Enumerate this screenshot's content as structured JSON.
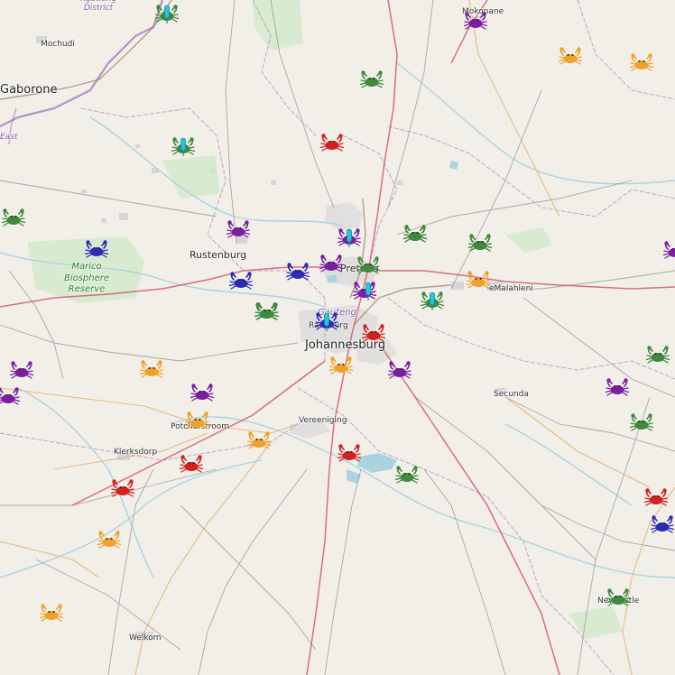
{
  "map": {
    "places": {
      "gaborone": "Gaborone",
      "mochudi": "Mochudi",
      "mokopane": "Mokopane",
      "rustenburg": "Rustenburg",
      "pretoria": "Pretoria",
      "randburg": "Randburg",
      "johannesburg": "Johannesburg",
      "emalahleni": "eMalahleni",
      "secunda": "Secunda",
      "potchefstroom": "Potchefstroom",
      "vereeniging": "Vereeniging",
      "klerksdorp": "Klerksdorp",
      "welkom": "Welkom",
      "newcastle": "Newcastle"
    },
    "regions": {
      "gauteng": "Gauteng",
      "marico": "Marico Biosphere Reserve",
      "kgatleng": "Kgatleng District",
      "east": "East"
    },
    "crab_colors": {
      "green": "#3f8a3f",
      "purple": "#7b1fa2",
      "blue": "#2b2bb8",
      "orange": "#f0a12a",
      "red": "#d32020"
    },
    "pin_color": "#22c8d4",
    "crab_count": 48,
    "pin_count": 6
  }
}
